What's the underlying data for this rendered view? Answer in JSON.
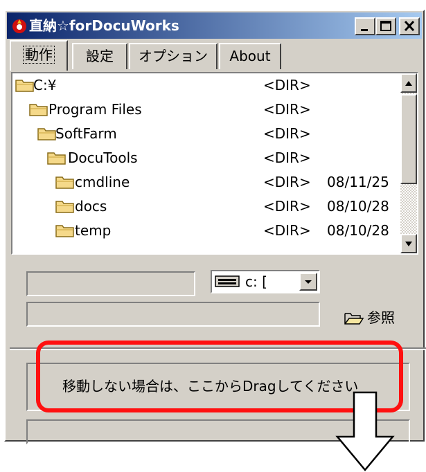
{
  "window": {
    "title": "直納☆forDocuWorks",
    "buttons": {
      "minimize": "minimize",
      "maximize": "maximize",
      "close": "close"
    }
  },
  "tabs": [
    {
      "label": "動作",
      "active": true
    },
    {
      "label": "設定",
      "active": false
    },
    {
      "label": "オプション",
      "active": false
    },
    {
      "label": "About",
      "active": false
    }
  ],
  "file_list": [
    {
      "name": "C:¥",
      "dir": "<DIR>",
      "date": "",
      "indent": 0
    },
    {
      "name": "Program Files",
      "dir": "<DIR>",
      "date": "",
      "indent": 1
    },
    {
      "name": "SoftFarm",
      "dir": "<DIR>",
      "date": "",
      "indent": 2
    },
    {
      "name": "DocuTools",
      "dir": "<DIR>",
      "date": "",
      "indent": 3
    },
    {
      "name": "cmdline",
      "dir": "<DIR>",
      "date": "08/11/25",
      "indent": 4
    },
    {
      "name": "docs",
      "dir": "<DIR>",
      "date": "08/10/28",
      "indent": 4
    },
    {
      "name": "temp",
      "dir": "<DIR>",
      "date": "08/10/28",
      "indent": 4
    }
  ],
  "drive_select": {
    "value": "c: ["
  },
  "browse_label": "参照",
  "drop_area": {
    "text": "移動しない場合は、ここからDragしてください"
  },
  "colors": {
    "highlight": "#ff1010",
    "titlebar_start": "#0a246a",
    "titlebar_end": "#a6caf0"
  },
  "icons": {
    "app": "app-icon",
    "folder": "folder-icon",
    "drive": "drive-icon",
    "browse": "open-folder-icon",
    "arrow": "down-arrow-icon"
  }
}
